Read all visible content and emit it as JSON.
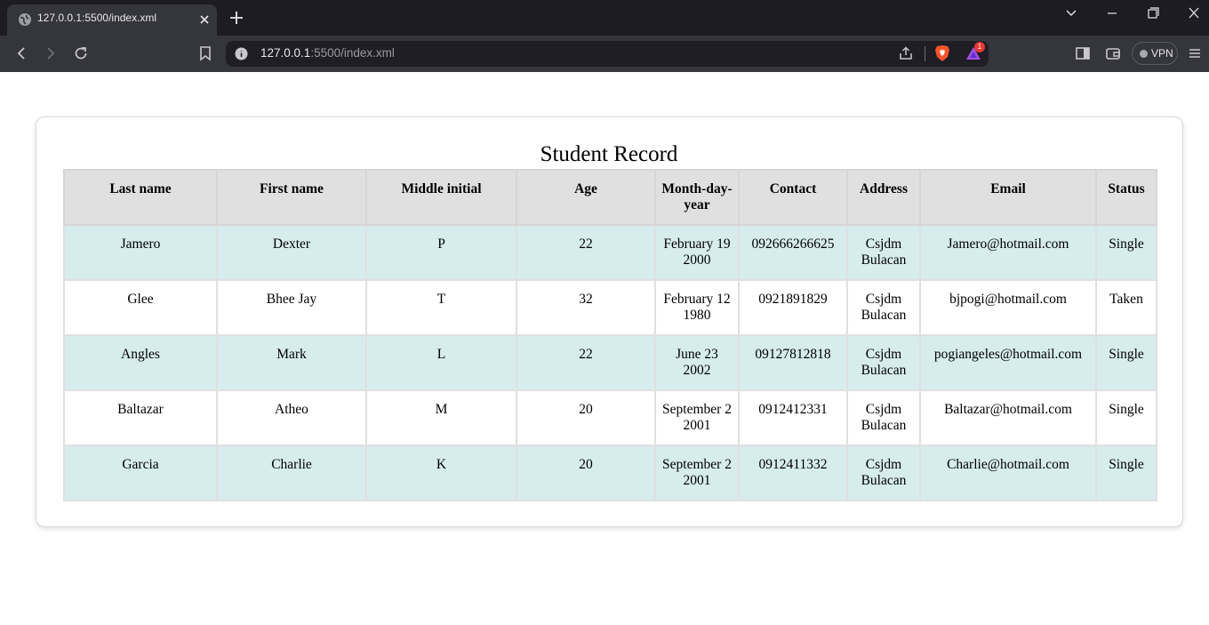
{
  "browser": {
    "tab": {
      "title": "127.0.0.1:5500/index.xml"
    },
    "address": {
      "host": "127.0.0.1",
      "path": ":5500/index.xml"
    },
    "rewards_badge": "1",
    "vpn_label": "VPN",
    "colors": {
      "frame": "#1c1c22",
      "toolbar": "#35353c",
      "omnibox": "#1e1e24",
      "brave": "#fb542b"
    }
  },
  "page": {
    "title": "Student Record",
    "table": {
      "headers": [
        "Last name",
        "First name",
        "Middle initial",
        "Age",
        "Month-day-year",
        "Contact",
        "Address",
        "Email",
        "Status"
      ],
      "rows": [
        [
          "Jamero",
          "Dexter",
          "P",
          "22",
          "February 19 2000",
          "092666266625",
          "Csjdm Bulacan",
          "Jamero@hotmail.com",
          "Single"
        ],
        [
          "Glee",
          "Bhee Jay",
          "T",
          "32",
          "February 12 1980",
          "0921891829",
          "Csjdm Bulacan",
          "bjpogi@hotmail.com",
          "Taken"
        ],
        [
          "Angles",
          "Mark",
          "L",
          "22",
          "June 23 2002",
          "09127812818",
          "Csjdm Bulacan",
          "pogiangeles@hotmail.com",
          "Single"
        ],
        [
          "Baltazar",
          "Atheo",
          "M",
          "20",
          "September 2 2001",
          "0912412331",
          "Csjdm Bulacan",
          "Baltazar@hotmail.com",
          "Single"
        ],
        [
          "Garcia",
          "Charlie",
          "K",
          "20",
          "September 2 2001",
          "0912411332",
          "Csjdm Bulacan",
          "Charlie@hotmail.com",
          "Single"
        ]
      ]
    },
    "colors": {
      "header_bg": "#e0e0e0",
      "stripe_bg": "#d6eced",
      "border": "#e0e0e0"
    }
  }
}
